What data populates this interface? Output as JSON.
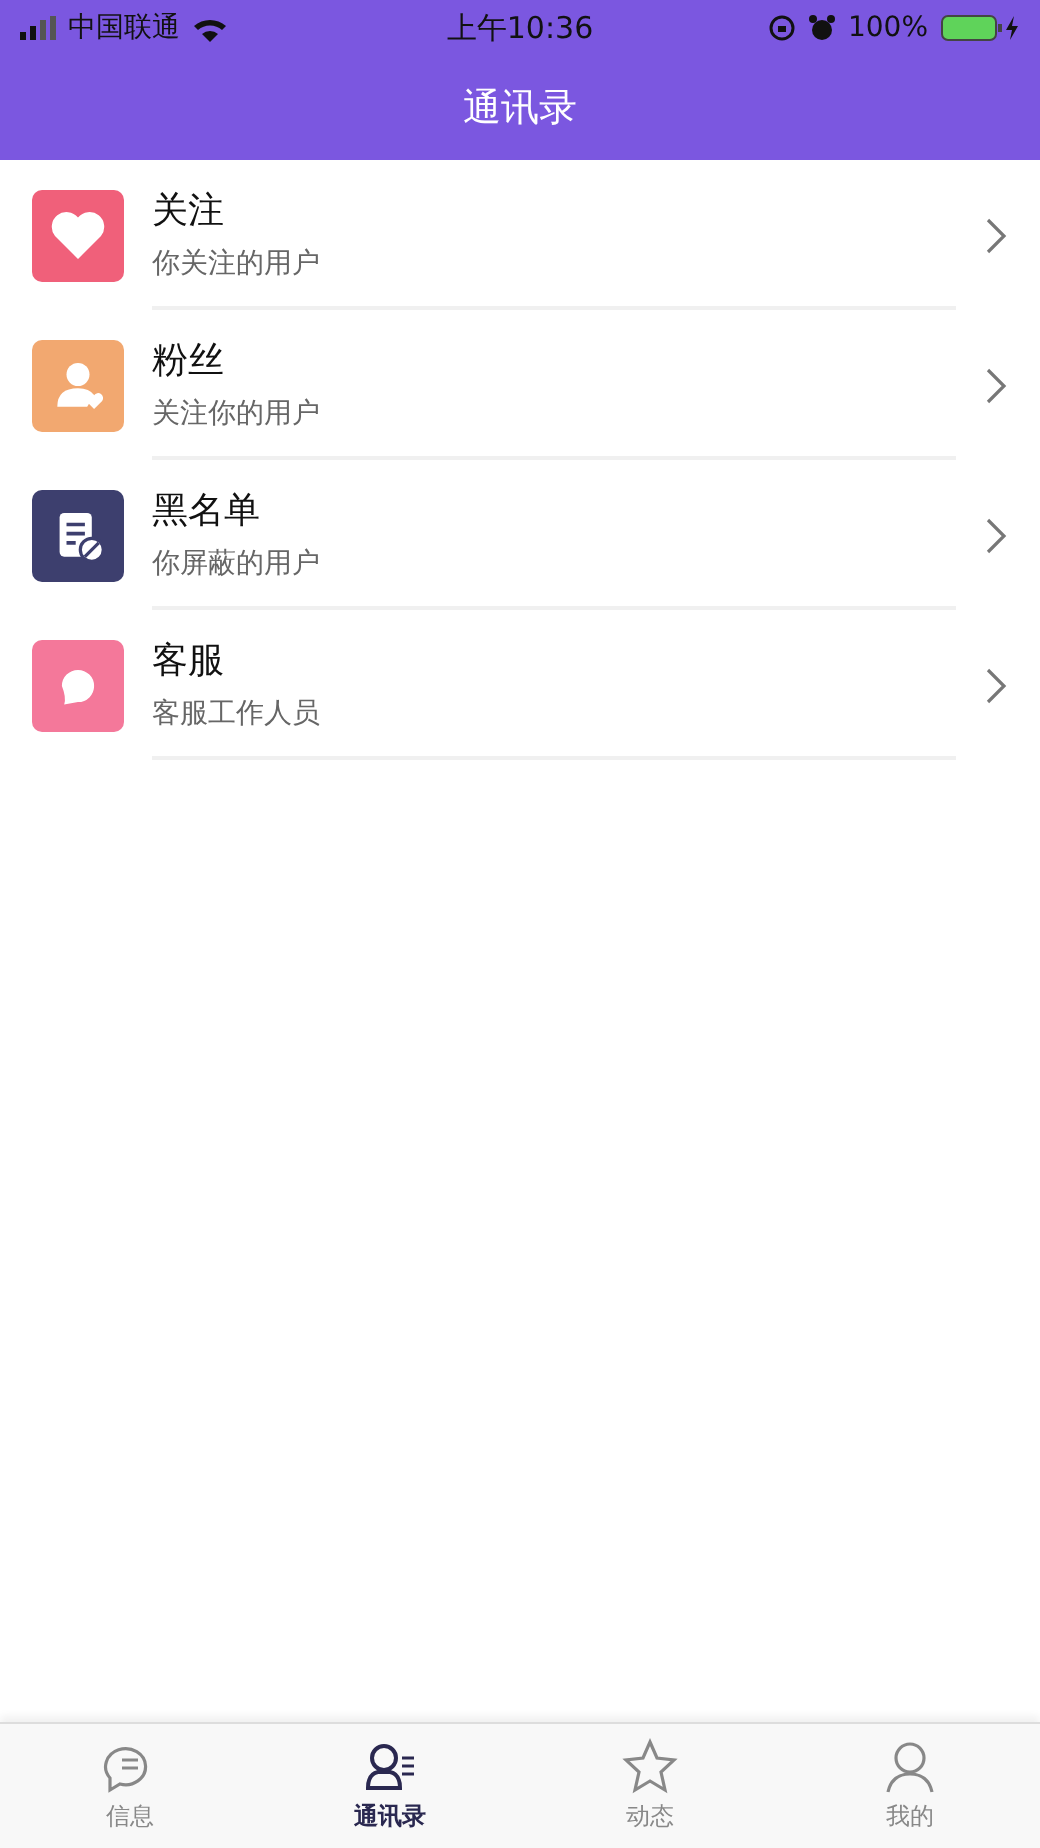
{
  "status_bar": {
    "carrier": "中国联通",
    "time": "上午10:36",
    "battery": "100%"
  },
  "nav": {
    "title": "通讯录"
  },
  "items": [
    {
      "kind": "heart",
      "color": "#f0607a",
      "title": "关注",
      "subtitle": "你关注的用户"
    },
    {
      "kind": "person",
      "color": "#f2a870",
      "title": "粉丝",
      "subtitle": "关注你的用户"
    },
    {
      "kind": "list",
      "color": "#3d3f6e",
      "title": "黑名单",
      "subtitle": "你屏蔽的用户"
    },
    {
      "kind": "chat",
      "color": "#f4789a",
      "title": "客服",
      "subtitle": "客服工作人员"
    }
  ],
  "tabs": [
    {
      "kind": "chat",
      "label": "信息",
      "selected": false
    },
    {
      "kind": "contacts",
      "label": "通讯录",
      "selected": true
    },
    {
      "kind": "star",
      "label": "动态",
      "selected": false
    },
    {
      "kind": "person",
      "label": "我的",
      "selected": false
    }
  ]
}
